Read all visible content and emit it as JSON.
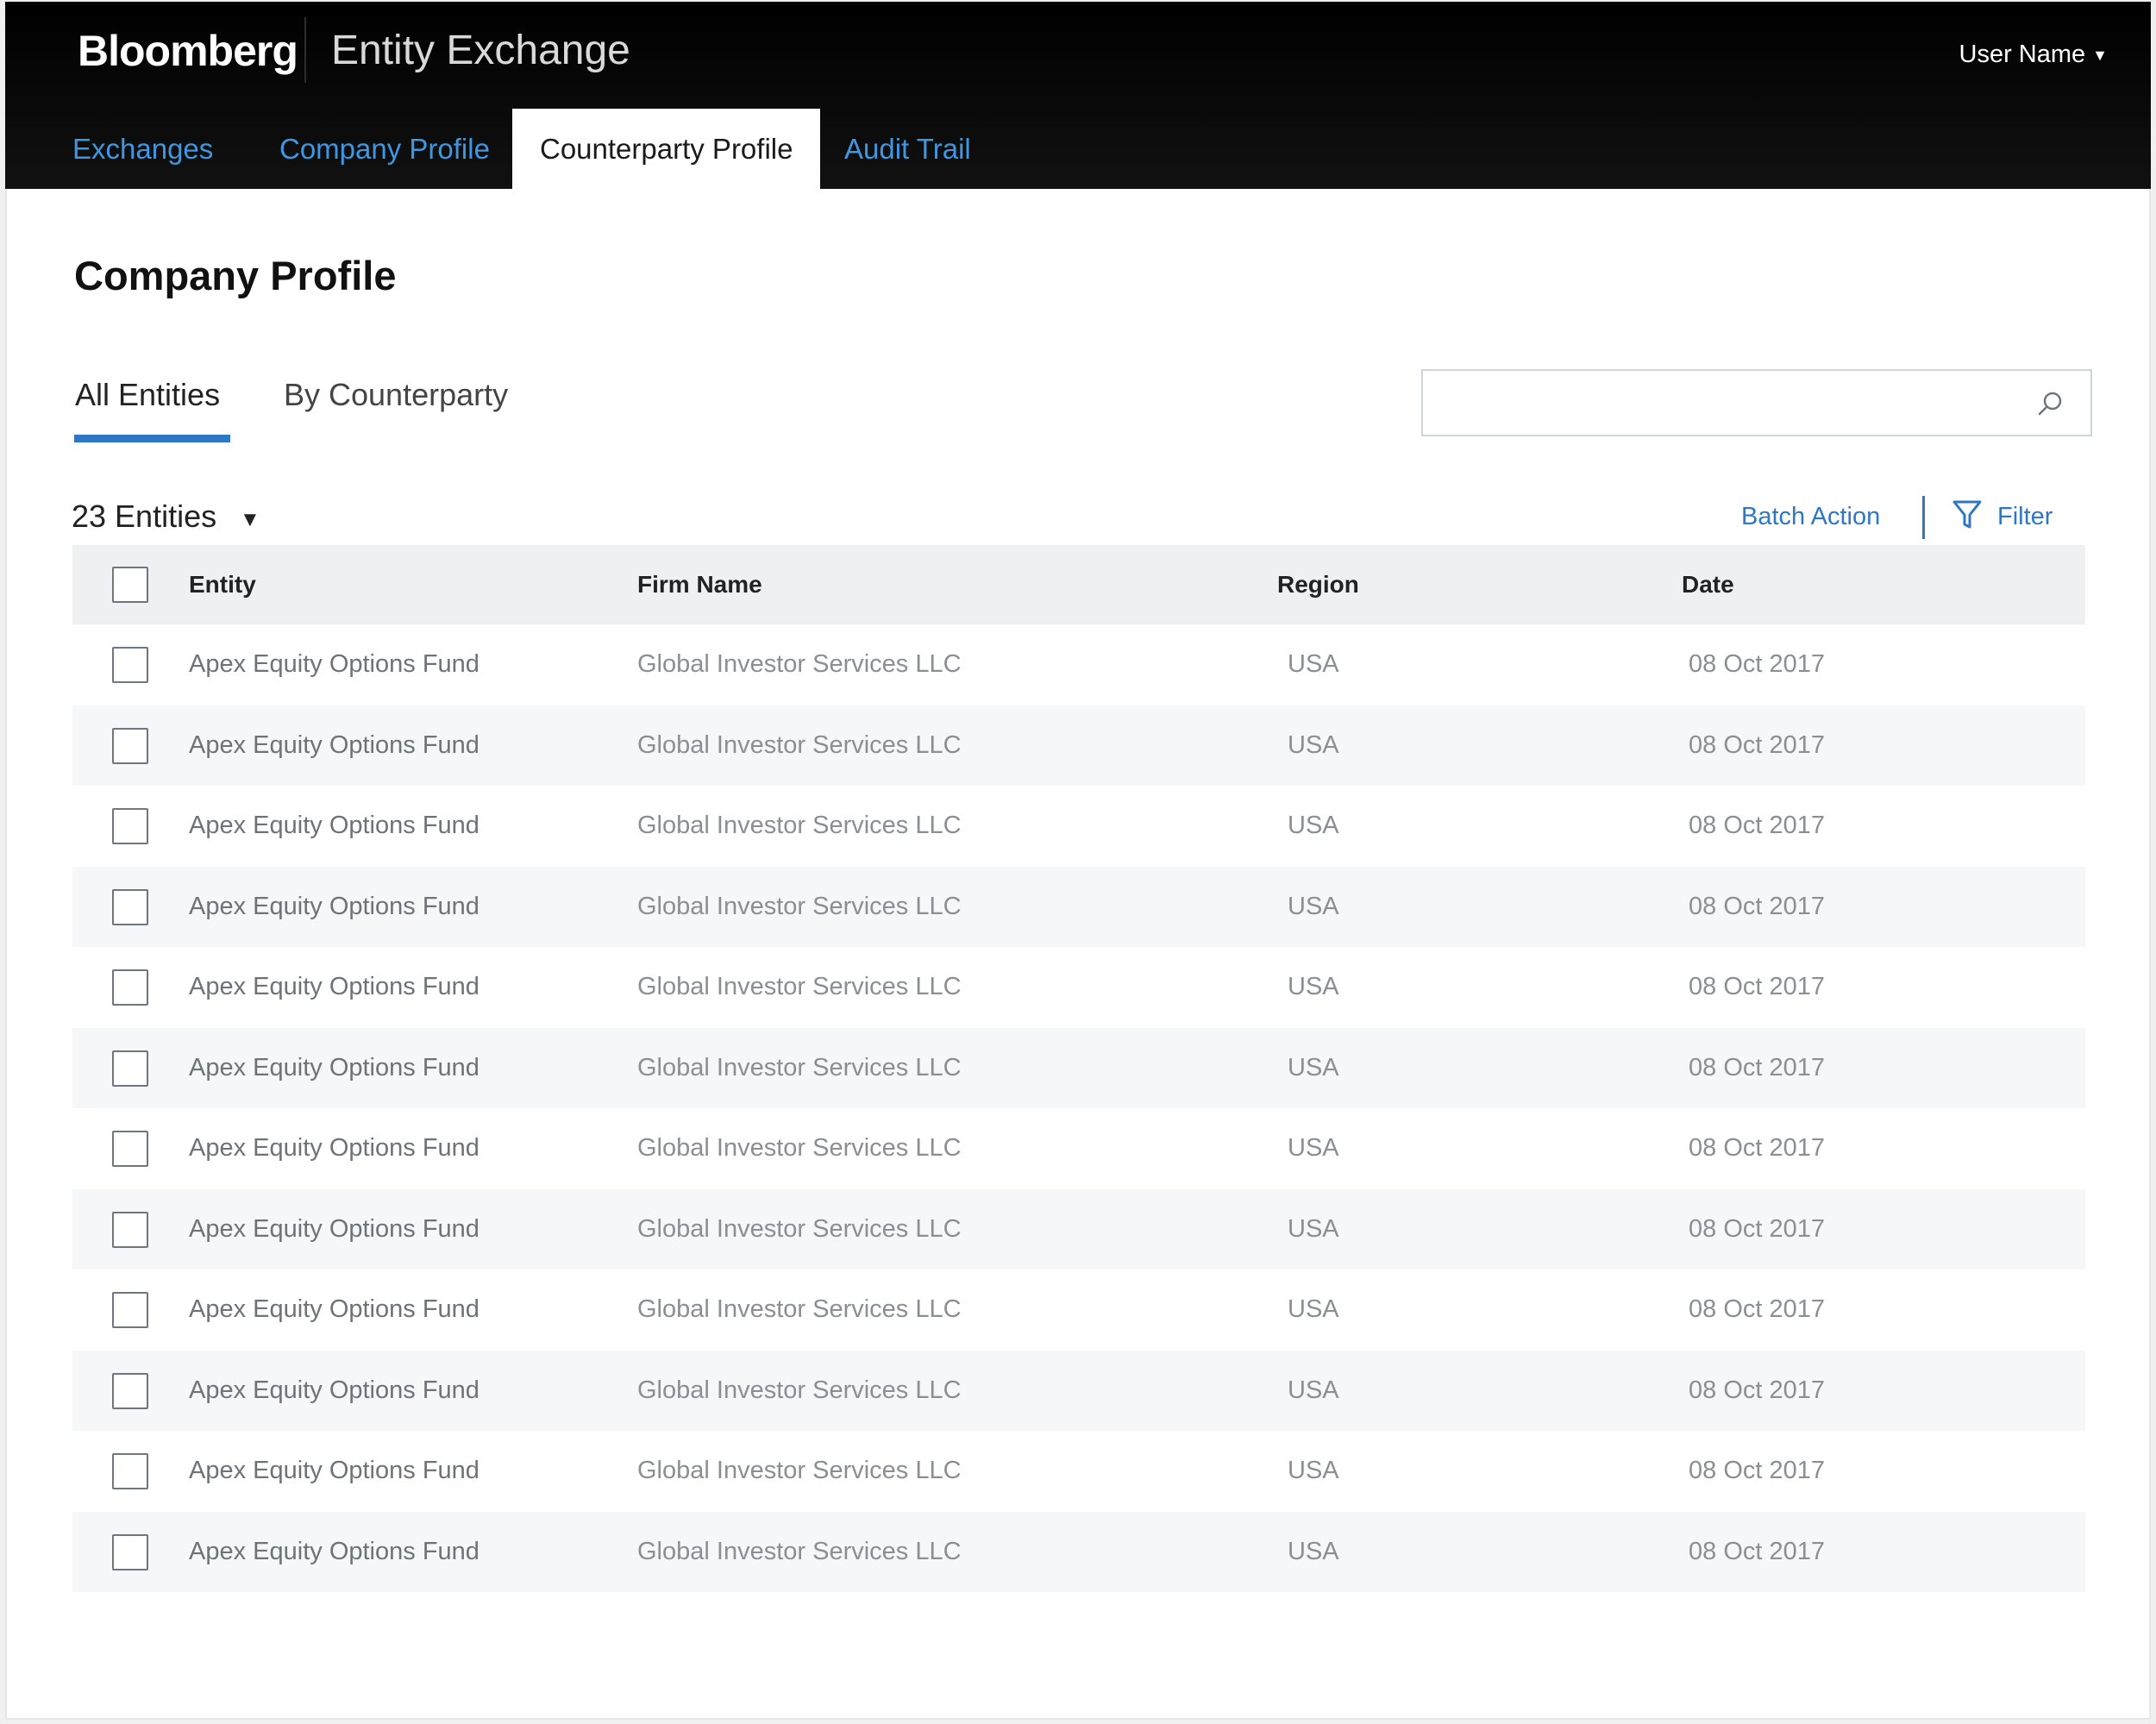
{
  "header": {
    "brand": "Bloomberg",
    "app_title": "Entity Exchange",
    "user_menu": "User Name",
    "tabs": [
      {
        "label": "Exchanges",
        "active": false
      },
      {
        "label": "Company Profile",
        "active": false
      },
      {
        "label": "Counterparty Profile",
        "active": true
      },
      {
        "label": "Audit Trail",
        "active": false
      }
    ]
  },
  "page": {
    "title": "Company Profile",
    "subtabs": [
      {
        "label": "All Entities",
        "active": true
      },
      {
        "label": "By Counterparty",
        "active": false
      }
    ],
    "search": {
      "value": "",
      "placeholder": ""
    },
    "entity_count": "23 Entities",
    "batch_action": "Batch Action",
    "filter": "Filter"
  },
  "table": {
    "columns": [
      "Entity",
      "Firm Name",
      "Region",
      "Date"
    ],
    "rows": [
      {
        "entity": "Apex Equity Options Fund",
        "firm": "Global Investor Services LLC",
        "region": "USA",
        "date": "08 Oct 2017"
      },
      {
        "entity": "Apex Equity Options Fund",
        "firm": "Global Investor Services LLC",
        "region": "USA",
        "date": "08 Oct 2017"
      },
      {
        "entity": "Apex Equity Options Fund",
        "firm": "Global Investor Services LLC",
        "region": "USA",
        "date": "08 Oct 2017"
      },
      {
        "entity": "Apex Equity Options Fund",
        "firm": "Global Investor Services LLC",
        "region": "USA",
        "date": "08 Oct 2017"
      },
      {
        "entity": "Apex Equity Options Fund",
        "firm": "Global Investor Services LLC",
        "region": "USA",
        "date": "08 Oct 2017"
      },
      {
        "entity": "Apex Equity Options Fund",
        "firm": "Global Investor Services LLC",
        "region": "USA",
        "date": "08 Oct 2017"
      },
      {
        "entity": "Apex Equity Options Fund",
        "firm": "Global Investor Services LLC",
        "region": "USA",
        "date": "08 Oct 2017"
      },
      {
        "entity": "Apex Equity Options Fund",
        "firm": "Global Investor Services LLC",
        "region": "USA",
        "date": "08 Oct 2017"
      },
      {
        "entity": "Apex Equity Options Fund",
        "firm": "Global Investor Services LLC",
        "region": "USA",
        "date": "08 Oct 2017"
      },
      {
        "entity": "Apex Equity Options Fund",
        "firm": "Global Investor Services LLC",
        "region": "USA",
        "date": "08 Oct 2017"
      },
      {
        "entity": "Apex Equity Options Fund",
        "firm": "Global Investor Services LLC",
        "region": "USA",
        "date": "08 Oct 2017"
      },
      {
        "entity": "Apex Equity Options Fund",
        "firm": "Global Investor Services LLC",
        "region": "USA",
        "date": "08 Oct 2017"
      }
    ]
  },
  "colors": {
    "header_bg": "#000000",
    "tab_link": "#3f97e1",
    "accent": "#2f77c4",
    "row_alt": "#f6f7f9",
    "header_row_bg": "#eef0f2"
  },
  "icons": {
    "search": "search-icon",
    "filter": "filter-icon",
    "user_caret": "caret-down-icon",
    "count_caret": "caret-down-icon"
  }
}
